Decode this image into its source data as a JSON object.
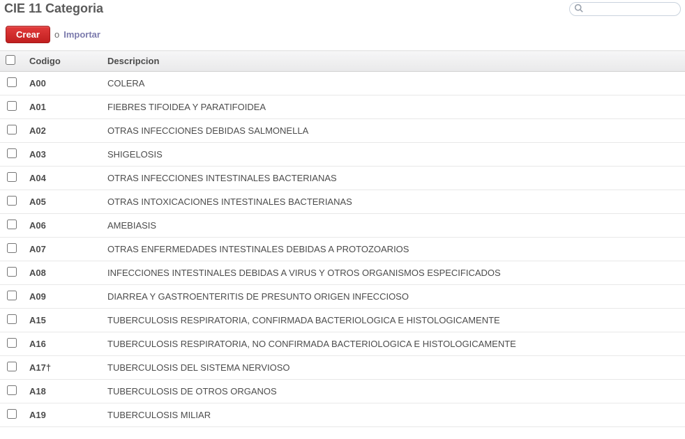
{
  "header": {
    "title": "CIE 11 Categoria",
    "search_value": ""
  },
  "toolbar": {
    "create_label": "Crear",
    "or_text": "o",
    "import_label": "Importar"
  },
  "table": {
    "columns": {
      "codigo": "Codigo",
      "descripcion": "Descripcion"
    },
    "rows": [
      {
        "codigo": "A00",
        "descripcion": "COLERA"
      },
      {
        "codigo": "A01",
        "descripcion": "FIEBRES TIFOIDEA Y PARATIFOIDEA"
      },
      {
        "codigo": "A02",
        "descripcion": "OTRAS INFECCIONES DEBIDAS SALMONELLA"
      },
      {
        "codigo": "A03",
        "descripcion": "SHIGELOSIS"
      },
      {
        "codigo": "A04",
        "descripcion": "OTRAS INFECCIONES INTESTINALES BACTERIANAS"
      },
      {
        "codigo": "A05",
        "descripcion": "OTRAS INTOXICACIONES INTESTINALES BACTERIANAS"
      },
      {
        "codigo": "A06",
        "descripcion": "AMEBIASIS"
      },
      {
        "codigo": "A07",
        "descripcion": "OTRAS ENFERMEDADES INTESTINALES DEBIDAS A PROTOZOARIOS"
      },
      {
        "codigo": "A08",
        "descripcion": "INFECCIONES INTESTINALES DEBIDAS A VIRUS Y OTROS ORGANISMOS ESPECIFICADOS"
      },
      {
        "codigo": "A09",
        "descripcion": "DIARREA Y GASTROENTERITIS DE PRESUNTO ORIGEN INFECCIOSO"
      },
      {
        "codigo": "A15",
        "descripcion": "TUBERCULOSIS RESPIRATORIA, CONFIRMADA BACTERIOLOGICA E HISTOLOGICAMENTE"
      },
      {
        "codigo": "A16",
        "descripcion": "TUBERCULOSIS RESPIRATORIA, NO CONFIRMADA BACTERIOLOGICA E HISTOLOGICAMENTE"
      },
      {
        "codigo": "A17†",
        "descripcion": "TUBERCULOSIS DEL SISTEMA NERVIOSO"
      },
      {
        "codigo": "A18",
        "descripcion": "TUBERCULOSIS DE OTROS ORGANOS"
      },
      {
        "codigo": "A19",
        "descripcion": "TUBERCULOSIS MILIAR"
      }
    ]
  }
}
